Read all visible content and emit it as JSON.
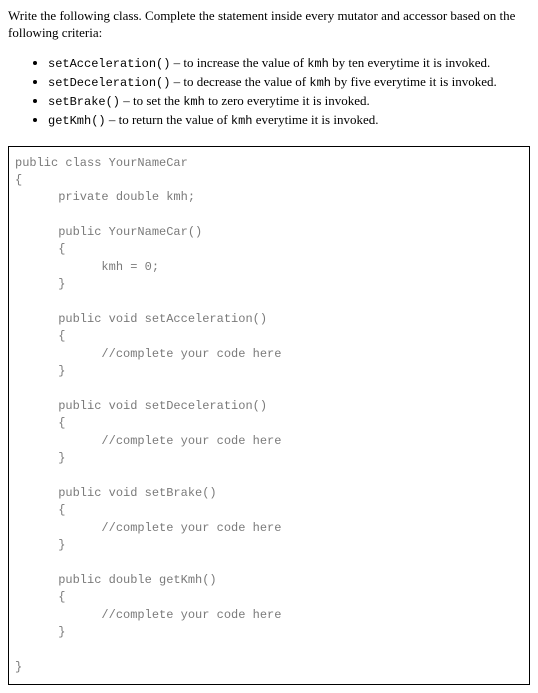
{
  "intro": "Write the following class. Complete the statement inside every mutator and accessor based on the following criteria:",
  "bullets": [
    {
      "code": "setAcceleration()",
      "rest": " – to increase the value of ",
      "var": "kmh",
      "tail": " by ten everytime it is invoked."
    },
    {
      "code": "setDeceleration()",
      "rest": " – to decrease the value of ",
      "var": "kmh",
      "tail": " by five everytime it is invoked."
    },
    {
      "code": "setBrake()",
      "rest": " – to set the ",
      "var": "kmh",
      "tail": " to zero everytime it is invoked."
    },
    {
      "code": "getKmh()",
      "rest": " – to return the value of ",
      "var": "kmh",
      "tail": " everytime it is invoked."
    }
  ],
  "code": "public class YourNameCar\n{\n      private double kmh;\n\n      public YourNameCar()\n      {\n            kmh = 0;\n      }\n\n      public void setAcceleration()\n      {\n            //complete your code here\n      }\n\n      public void setDeceleration()\n      {\n            //complete your code here\n      }\n\n      public void setBrake()\n      {\n            //complete your code here\n      }\n\n      public double getKmh()\n      {\n            //complete your code here\n      }\n\n}"
}
